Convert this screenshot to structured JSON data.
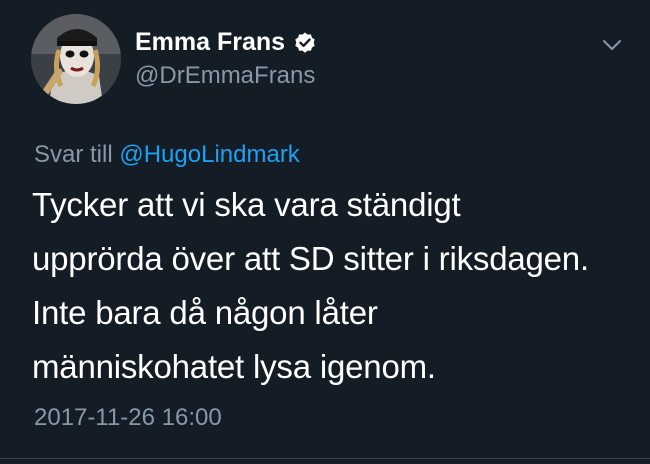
{
  "author": {
    "display_name": "Emma Frans",
    "handle": "@DrEmmaFrans",
    "verified": true,
    "avatar_icon": "profile-photo"
  },
  "reply": {
    "prefix": "Svar till",
    "mention": "@HugoLindmark"
  },
  "tweet": {
    "lines": [
      "Tycker att vi ska vara ständigt",
      "upprörda över att SD sitter i riksdagen.",
      "Inte bara då någon låter",
      "människohatet lysa igenom."
    ],
    "timestamp": "2017-11-26 16:00"
  },
  "icons": {
    "verified": "verified-badge-icon",
    "more": "chevron-down-icon"
  },
  "colors": {
    "background": "#141d26",
    "secondary_text": "#8899a6",
    "link": "#1da1f2",
    "primary_text": "#ffffff"
  }
}
